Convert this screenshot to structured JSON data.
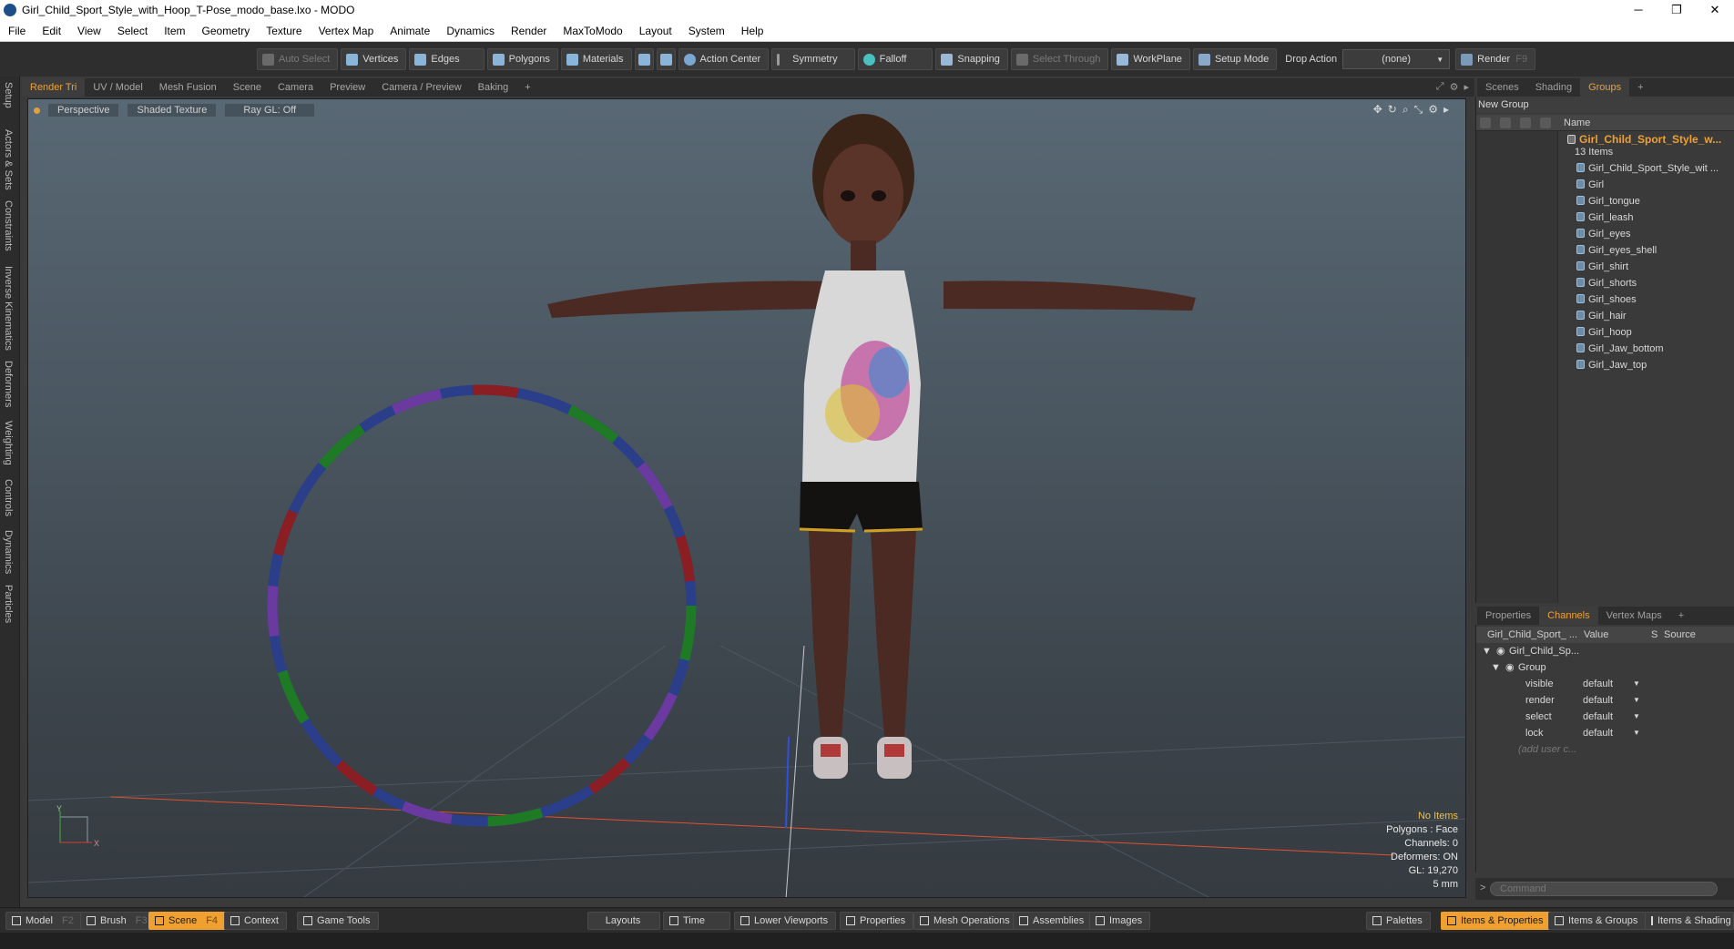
{
  "window": {
    "title": "Girl_Child_Sport_Style_with_Hoop_T-Pose_modo_base.lxo - MODO",
    "minimize": "─",
    "restore": "❐",
    "close": "✕"
  },
  "menu": [
    "File",
    "Edit",
    "View",
    "Select",
    "Item",
    "Geometry",
    "Texture",
    "Vertex Map",
    "Animate",
    "Dynamics",
    "Render",
    "MaxToModo",
    "Layout",
    "System",
    "Help"
  ],
  "toolbar": {
    "auto_select": "Auto Select",
    "vertices": "Vertices",
    "edges": "Edges",
    "polygons": "Polygons",
    "materials": "Materials",
    "action_center": "Action Center",
    "symmetry": "Symmetry",
    "falloff": "Falloff",
    "snapping": "Snapping",
    "select_through": "Select Through",
    "workplane": "WorkPlane",
    "setup_mode": "Setup Mode",
    "drop_action_label": "Drop Action",
    "drop_action_value": "(none)",
    "render": "Render",
    "render_key": "F9"
  },
  "left_tabs": [
    "Setup",
    "Actors & Sets",
    "Constraints",
    "Inverse Kinematics",
    "Deformers",
    "Weighting",
    "Controls",
    "Dynamics",
    "Particles"
  ],
  "viewport_tabs": [
    "Render Tri",
    "UV / Model",
    "Mesh Fusion",
    "Scene",
    "Camera",
    "Preview",
    "Camera / Preview",
    "Baking",
    "+"
  ],
  "viewport": {
    "view": "Perspective",
    "shading": "Shaded Texture",
    "raygl": "Ray GL: Off",
    "info": {
      "items": "No Items",
      "polygons": "Polygons : Face",
      "channels": "Channels: 0",
      "deformers": "Deformers: ON",
      "gl": "GL: 19,270",
      "unit": "5 mm"
    }
  },
  "right_tabs": [
    "Scenes",
    "Shading",
    "Groups",
    "+"
  ],
  "groups": {
    "new_group": "New Group",
    "name_col": "Name",
    "group_name": "Girl_Child_Sport_Style_w...",
    "count": "13 Items",
    "items": [
      "Girl_Child_Sport_Style_wit ...",
      "Girl",
      "Girl_tongue",
      "Girl_leash",
      "Girl_eyes",
      "Girl_eyes_shell",
      "Girl_shirt",
      "Girl_shorts",
      "Girl_shoes",
      "Girl_hair",
      "Girl_hoop",
      "Girl_Jaw_bottom",
      "Girl_Jaw_top"
    ]
  },
  "lower_tabs": [
    "Properties",
    "Channels",
    "Vertex Maps",
    "+"
  ],
  "channels": {
    "col_name": "Girl_Child_Sport_ ...",
    "col_value": "Value",
    "col_s": "S",
    "col_source": "Source",
    "root": "Girl_Child_Sp...",
    "group": "Group",
    "rows": [
      {
        "name": "visible",
        "value": "default"
      },
      {
        "name": "render",
        "value": "default"
      },
      {
        "name": "select",
        "value": "default"
      },
      {
        "name": "lock",
        "value": "default"
      }
    ],
    "add_user": "(add user c..."
  },
  "command": {
    "prompt": ">",
    "placeholder": "Command"
  },
  "bottom": {
    "model": "Model",
    "model_key": "F2",
    "brush": "Brush",
    "brush_key": "F3",
    "scene": "Scene",
    "scene_key": "F4",
    "context": "Context",
    "game_tools": "Game Tools",
    "layouts": "Layouts",
    "time": "Time",
    "lower_viewports": "Lower Viewports",
    "properties": "Properties",
    "mesh_operations": "Mesh Operations",
    "assemblies": "Assemblies",
    "images": "Images",
    "palettes": "Palettes",
    "items_properties": "Items & Properties",
    "items_groups": "Items & Groups",
    "items_shading": "Items & Shading"
  },
  "colors": {
    "accent": "#f0a030",
    "axis_x": "#e05030",
    "axis_y": "#5070e0"
  }
}
